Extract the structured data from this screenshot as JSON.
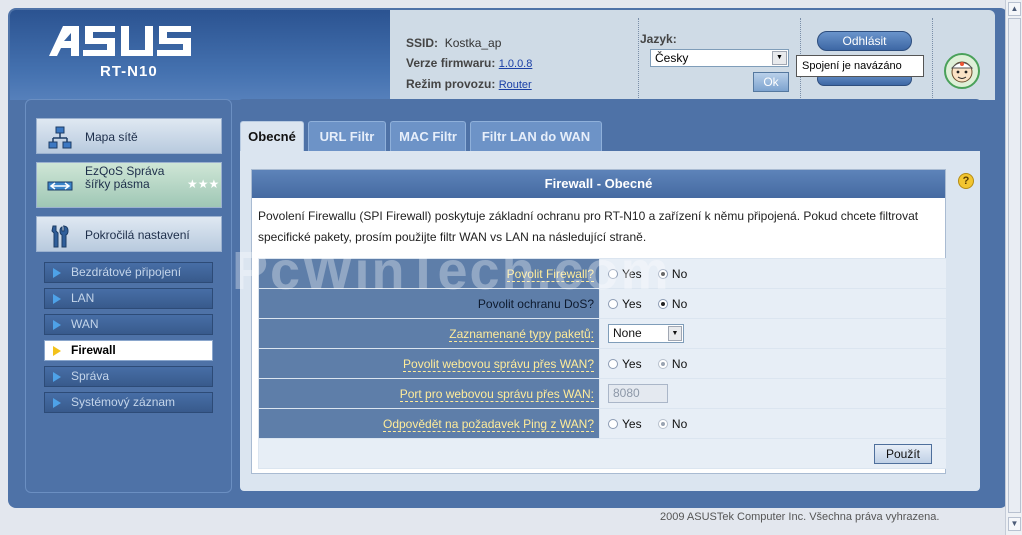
{
  "header": {
    "model": "RT-N10",
    "ssid_label": "SSID:",
    "ssid_value": "Kostka_ap",
    "firmware_label": "Verze firmwaru:",
    "firmware_value": "1.0.0.8",
    "mode_label": "Režim provozu:",
    "mode_value": "Router",
    "lang_label": "Jazyk:",
    "lang_value": "Česky",
    "ok_label": "Ok",
    "logout_label": "Odhlásit",
    "status_tooltip": "Spojení je navázáno"
  },
  "sidebar": {
    "main_items": [
      {
        "label": "Mapa sítě",
        "icon": "network-map-icon"
      },
      {
        "label": "EzQoS Správa šířky pásma",
        "icon": "ezqos-icon"
      },
      {
        "label": "Pokročilá nastavení",
        "icon": "tools-icon"
      }
    ],
    "sub_items": [
      {
        "label": "Bezdrátové připojení",
        "active": false
      },
      {
        "label": "LAN",
        "active": false
      },
      {
        "label": "WAN",
        "active": false
      },
      {
        "label": "Firewall",
        "active": true
      },
      {
        "label": "Správa",
        "active": false
      },
      {
        "label": "Systémový záznam",
        "active": false
      }
    ]
  },
  "tabs": [
    "Obecné",
    "URL Filtr",
    "MAC Filtr",
    "Filtr LAN do WAN"
  ],
  "panel": {
    "title": "Firewall - Obecné",
    "description": "Povolení Firewallu (SPI Firewall) poskytuje základní ochranu pro RT-N10 a zařízení k němu připojená. Pokud chcete filtrovat specifické pakety, prosím použijte filtr WAN vs LAN na následující straně.",
    "rows": [
      {
        "label": "Povolit Firewall?",
        "yes": "Yes",
        "no": "No",
        "selected": "No"
      },
      {
        "label": "Povolit ochranu DoS?",
        "yes": "Yes",
        "no": "No",
        "selected": "No"
      },
      {
        "label": "Zaznamenané typy paketů:",
        "value": "None"
      },
      {
        "label": "Povolit webovou správu přes WAN?",
        "yes": "Yes",
        "no": "No",
        "selected": "No"
      },
      {
        "label": "Port pro webovou správu přes WAN:",
        "value": "8080"
      },
      {
        "label": "Odpovědět na požadavek Ping z WAN?",
        "yes": "Yes",
        "no": "No",
        "selected": "No"
      }
    ],
    "apply_label": "Použít"
  },
  "watermark": "PcWinTech.com",
  "footer": "2009 ASUSTek Computer Inc. Všechna práva vyhrazena.",
  "colors": {
    "frame": "#4e72a7",
    "accent": "#ffec9a",
    "panel_header": "#5d83b9"
  }
}
